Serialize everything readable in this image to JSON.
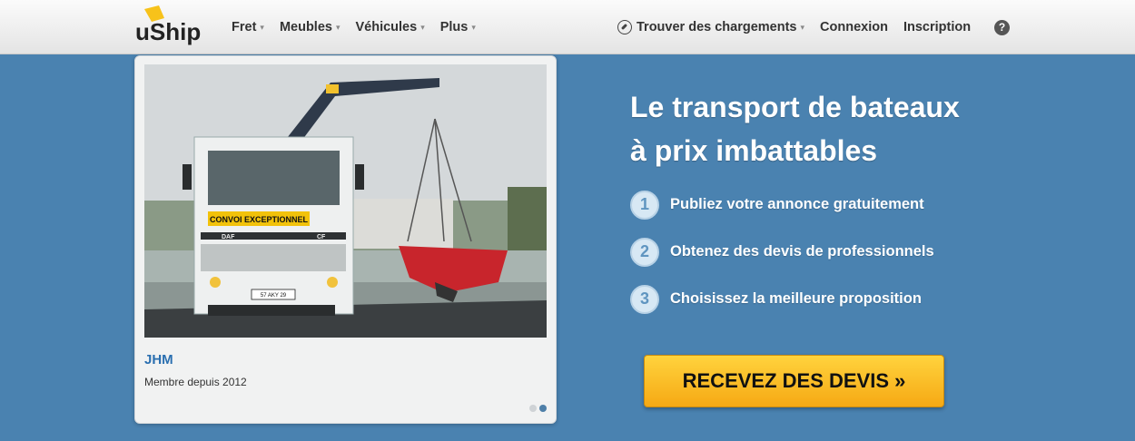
{
  "brand": {
    "logo_text": "uShip"
  },
  "nav": {
    "left": [
      {
        "label": "Fret"
      },
      {
        "label": "Meubles"
      },
      {
        "label": "Véhicules"
      },
      {
        "label": "Plus"
      }
    ],
    "find_loads": "Trouver des chargements",
    "login": "Connexion",
    "signup": "Inscription",
    "help": "?"
  },
  "testimonial": {
    "name": "JHM",
    "member_since": "Membre depuis 2012",
    "photo_sign": "CONVOI EXCEPTIONNEL",
    "plate": "57 AKY 29",
    "truck_brand": "DAF",
    "truck_model": "CF",
    "slides_total": 2,
    "slide_active": 2
  },
  "hero": {
    "headline_line1": "Le transport de bateaux",
    "headline_line2": "à prix imbattables",
    "steps": [
      {
        "num": "1",
        "text": "Publiez votre annonce gratuitement"
      },
      {
        "num": "2",
        "text": "Obtenez des devis de professionnels"
      },
      {
        "num": "3",
        "text": "Choisissez la meilleure proposition"
      }
    ],
    "cta": "RECEVEZ DES DEVIS »"
  },
  "colors": {
    "background": "#4a82b0",
    "cta": "#f9be24",
    "link": "#2a6fb0"
  }
}
